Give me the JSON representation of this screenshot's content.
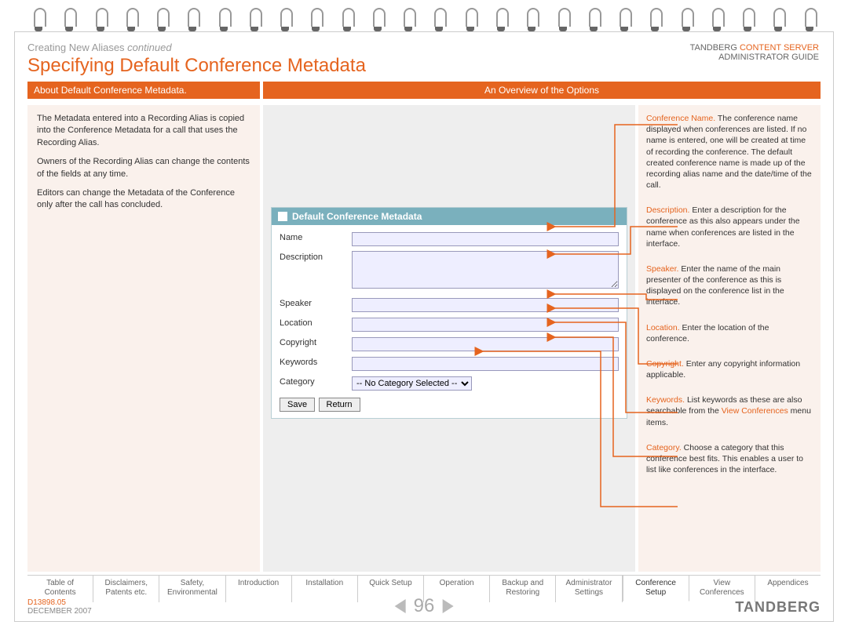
{
  "breadcrumb": {
    "main": "Creating New Aliases ",
    "cont": "continued"
  },
  "title": "Specifying Default Conference Metadata",
  "top_right": {
    "line1a": "TANDBERG ",
    "line1b": "CONTENT SERVER",
    "line2": "ADMINISTRATOR GUIDE"
  },
  "bars": {
    "left": "About Default Conference Metadata.",
    "right": "An Overview of the Options"
  },
  "left_col": {
    "p1": "The Metadata entered into a Recording Alias is copied into the Conference Metadata for a call that uses the Recording Alias.",
    "p2": "Owners of the Recording Alias can change the contents of the fields at any time.",
    "p3": "Editors can change the Metadata of the Conference only after the call has concluded."
  },
  "panel": {
    "header": "Default Conference Metadata",
    "labels": {
      "name": "Name",
      "description": "Description",
      "speaker": "Speaker",
      "location": "Location",
      "copyright": "Copyright",
      "keywords": "Keywords",
      "category": "Category"
    },
    "category_option": "-- No Category Selected --",
    "save": "Save",
    "return": "Return"
  },
  "right_col": {
    "i1": {
      "lbl": "Conference Name.",
      "txt": " The conference name displayed when conferences are listed. If no name is entered, one will be created at time of recording the conference. The default created conference name is made up of the recording alias name and the date/time of the call."
    },
    "i2": {
      "lbl": "Description.",
      "txt": " Enter a description for the conference as this also appears under the name when conferences are listed in the interface."
    },
    "i3": {
      "lbl": "Speaker.",
      "txt": " Enter the name of the main presenter of the conference as this is displayed on the conference list in the interface."
    },
    "i4": {
      "lbl": "Location.",
      "txt": " Enter the location of the conference."
    },
    "i5": {
      "lbl": "Copyright.",
      "txt": " Enter any copyright information applicable."
    },
    "i6": {
      "lbl": "Keywords.",
      "txt1": " List keywords as these are also searchable from the ",
      "link": "View Conferences",
      "txt2": " menu items."
    },
    "i7": {
      "lbl": "Category.",
      "txt": " Choose a category that this conference best fits. This enables a user to list like conferences in the interface."
    }
  },
  "tabs": [
    "Table of\nContents",
    "Disclaimers,\nPatents etc.",
    "Safety,\nEnvironmental",
    "Introduction",
    "Installation",
    "Quick Setup",
    "Operation",
    "Backup and\nRestoring",
    "Administrator\nSettings",
    "Conference\nSetup",
    "View\nConferences",
    "Appendices"
  ],
  "footer": {
    "docnum": "D13898.05",
    "date": "DECEMBER 2007",
    "page": "96",
    "brand": "TANDBERG"
  }
}
